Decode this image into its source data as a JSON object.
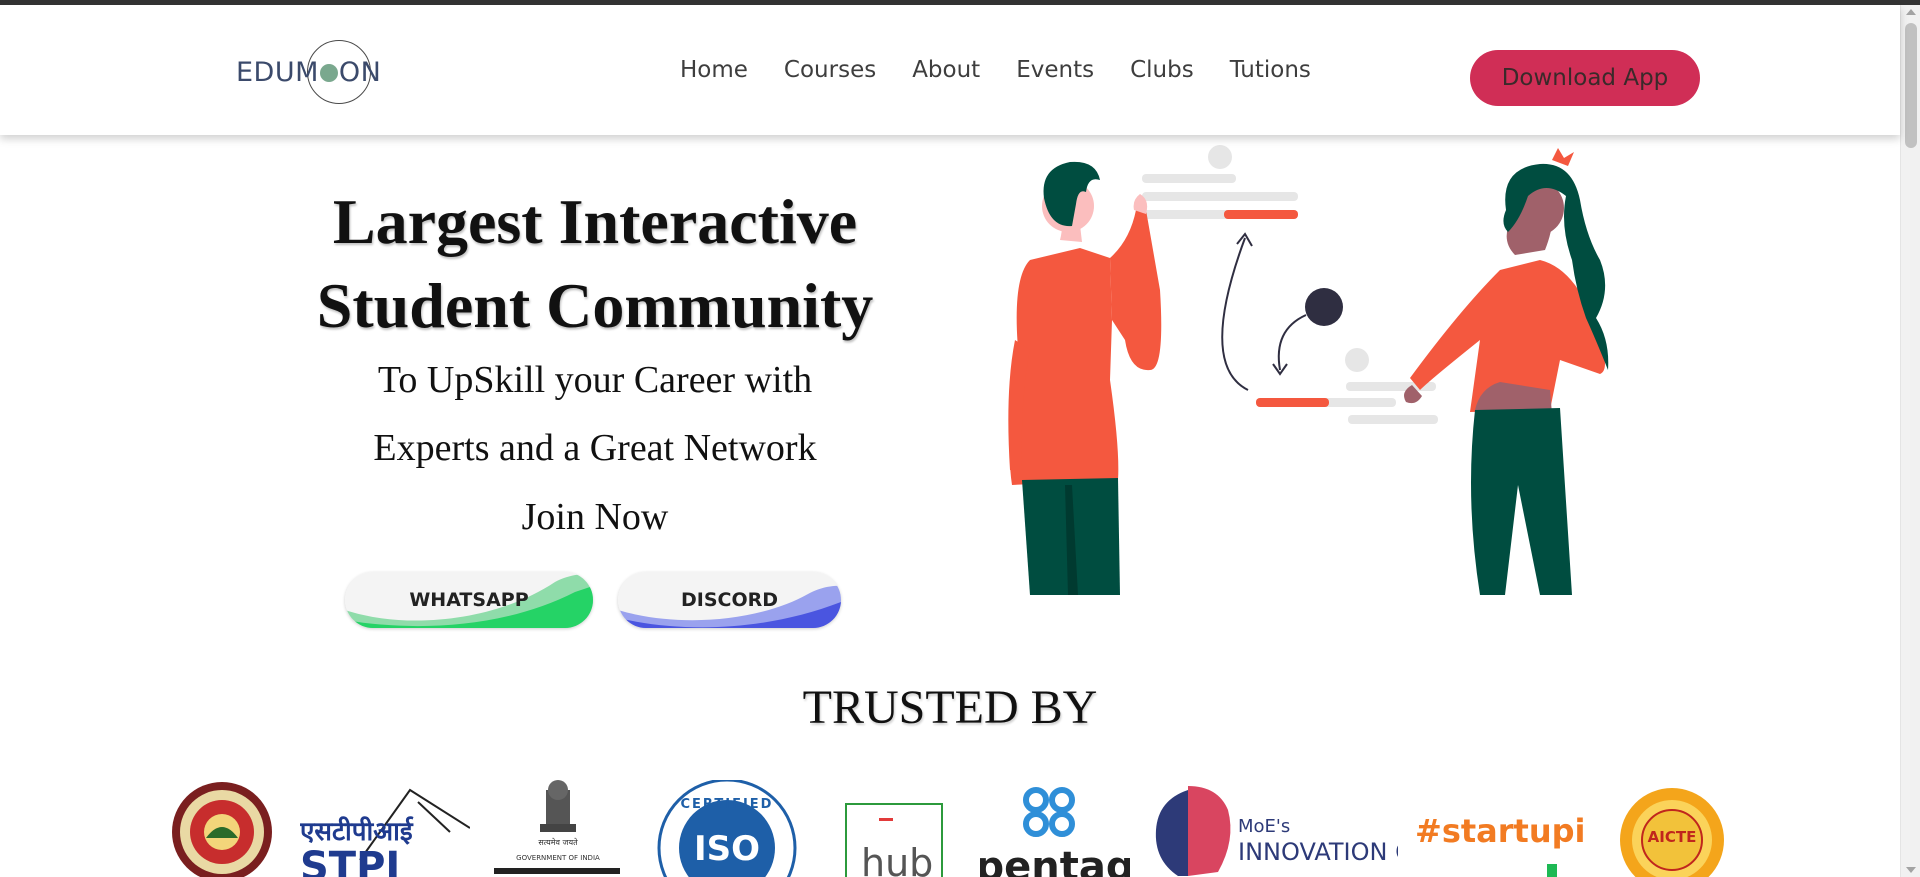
{
  "brand": {
    "logo_text_pre": "EDUM",
    "logo_text_post": "ON",
    "accent": "#d02e56"
  },
  "nav": {
    "items": [
      {
        "label": "Home"
      },
      {
        "label": "Courses"
      },
      {
        "label": "About"
      },
      {
        "label": "Events"
      },
      {
        "label": "Clubs"
      },
      {
        "label": "Tutions"
      }
    ],
    "download_label": "Download App"
  },
  "hero": {
    "title_line1": "Largest Interactive",
    "title_line2": "Student Community",
    "subtitle_line1": "To UpSkill your Career with",
    "subtitle_line2": "Experts and a Great Network",
    "join_label": "Join Now",
    "whatsapp_label": "WHATSAPP",
    "discord_label": "DISCORD",
    "whatsapp_color": "#25d366",
    "discord_color": "#4a55e0",
    "illustration_icon": "people-collaboration-illustration"
  },
  "trusted": {
    "title": "TRUSTED BY",
    "logos": [
      {
        "icon": "university-emblem-logo"
      },
      {
        "icon": "stpi-logo",
        "text": "एसटीपीआई",
        "text2": "STPI"
      },
      {
        "icon": "government-of-india-emblem-logo",
        "text": "GOVERNMENT OF INDIA",
        "text2": "सत्यमेव जयते"
      },
      {
        "icon": "iso-certified-logo",
        "text": "CERTIFIED",
        "text2": "ISO"
      },
      {
        "icon": "ahub-logo",
        "text": "hub"
      },
      {
        "icon": "pentag-logo",
        "text": "pentag"
      },
      {
        "icon": "moe-innovation-cell-logo",
        "text": "MoE's",
        "text2": "INNOVATION CELL"
      },
      {
        "icon": "startupindia-logo",
        "text": "#startupindia"
      },
      {
        "icon": "aicte-logo",
        "text": "AICTE"
      }
    ]
  }
}
